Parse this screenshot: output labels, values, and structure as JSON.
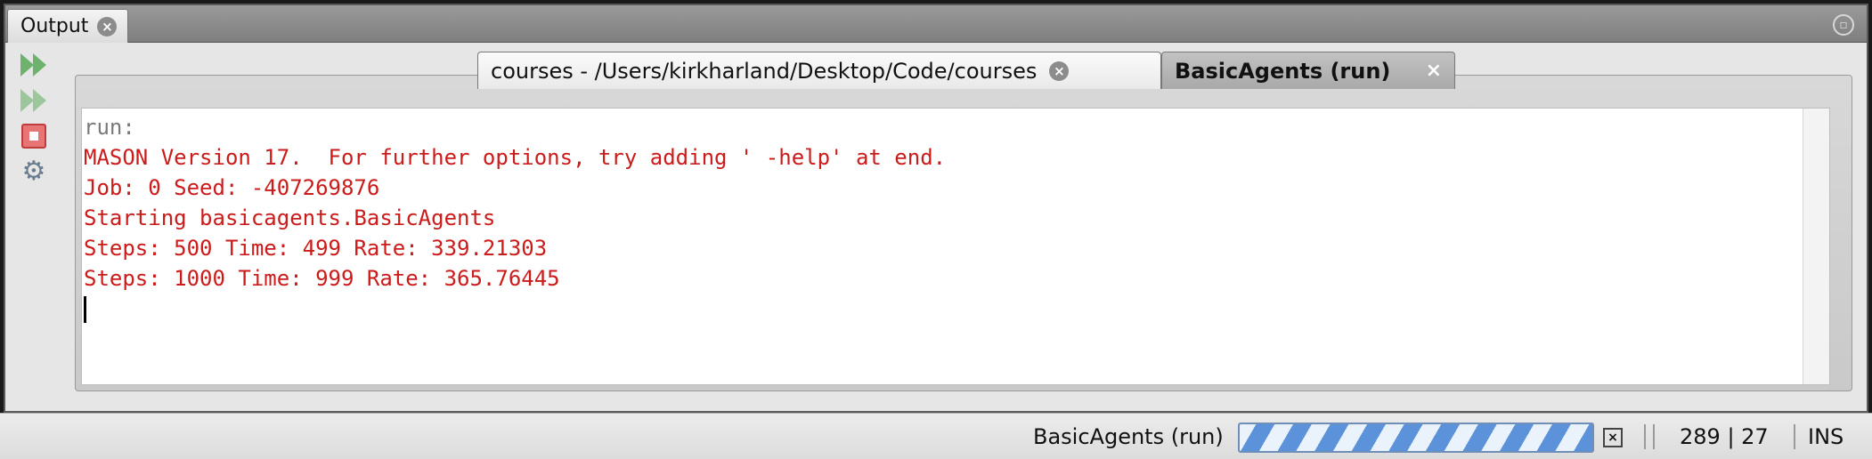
{
  "window": {
    "tab_label": "Output",
    "tab_close_glyph": "×",
    "restore_glyph": "▫"
  },
  "toolbar": {
    "icons": [
      "rerun-icon",
      "rerun-with-options-icon",
      "stop-icon",
      "settings-icon"
    ]
  },
  "inner_tabs": [
    {
      "label": "courses - /Users/kirkharland/Desktop/Code/courses",
      "close_glyph": "×",
      "active": false
    },
    {
      "label": "BasicAgents (run)",
      "close_glyph": "×",
      "active": true
    }
  ],
  "console": {
    "lines": [
      {
        "text": "run:",
        "color": "#7a7a7a"
      },
      {
        "text": "MASON Version 17.  For further options, try adding ' -help' at end.",
        "color": "#cc1b1b"
      },
      {
        "text": "Job: 0 Seed: -407269876",
        "color": "#cc1b1b"
      },
      {
        "text": "Starting basicagents.BasicAgents",
        "color": "#cc1b1b"
      },
      {
        "text": "Steps: 500 Time: 499 Rate: 339.21303",
        "color": "#cc1b1b"
      },
      {
        "text": "Steps: 1000 Time: 999 Rate: 365.76445",
        "color": "#cc1b1b"
      }
    ]
  },
  "statusbar": {
    "task_label": "BasicAgents (run)",
    "cancel_glyph": "×",
    "caret_position": "289 | 27",
    "insert_mode": "INS"
  },
  "colors": {
    "error_text": "#cc1b1b",
    "info_text": "#7a7a7a",
    "progress_stripe": "#5b92d9"
  }
}
